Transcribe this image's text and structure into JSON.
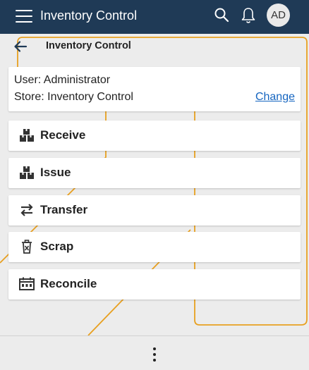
{
  "header": {
    "app_title": "Inventory Control",
    "avatar_initials": "AD",
    "bg_color": "#1f3a56",
    "icons": [
      "hamburger-icon",
      "search-icon",
      "bell-icon"
    ]
  },
  "page": {
    "title": "Inventory Control",
    "back_icon": "arrow-left-icon"
  },
  "info_card": {
    "user_line": "User: Administrator",
    "store_line": "Store: Inventory Control",
    "change_label": "Change",
    "link_color": "#1565c0"
  },
  "actions": [
    {
      "label": "Receive",
      "icon": "boxes-icon"
    },
    {
      "label": "Issue",
      "icon": "boxes-icon"
    },
    {
      "label": "Transfer",
      "icon": "swap-arrows-icon"
    },
    {
      "label": "Scrap",
      "icon": "trash-icon"
    },
    {
      "label": "Reconcile",
      "icon": "calendar-grid-icon"
    }
  ],
  "footer": {
    "more_icon": "more-vertical-icon"
  },
  "accent_color": "#e8a020"
}
